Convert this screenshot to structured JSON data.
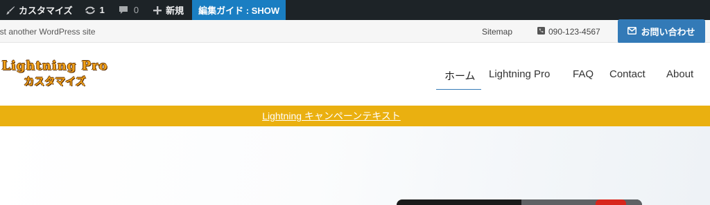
{
  "adminbar": {
    "customize_label": "カスタマイズ",
    "updates_count": "1",
    "comments_count": "0",
    "new_label": "新規",
    "guide_label": "編集ガイド : SHOW"
  },
  "header_top": {
    "tagline": "Just another WordPress site",
    "sitemap_label": "Sitemap",
    "phone": "090-123-4567",
    "contact_label": "お問い合わせ"
  },
  "logo": {
    "line1": "Lightning Pro",
    "line2": "カスタマイズ"
  },
  "nav": {
    "items": [
      {
        "label": "ホーム",
        "active": true
      },
      {
        "label": "Lightning Pro",
        "active": false
      },
      {
        "label": "FAQ",
        "active": false
      },
      {
        "label": "Contact",
        "active": false
      },
      {
        "label": "About",
        "active": false
      }
    ]
  },
  "campaign": {
    "text": "Lightning キャンペーンテキスト"
  },
  "colors": {
    "adminbar_bg": "#1d2327",
    "guide_bg": "#1a7ec2",
    "contact_button": "#337ab7",
    "campaign_bar": "#eab010",
    "logo_orange": "#f2a21a"
  }
}
